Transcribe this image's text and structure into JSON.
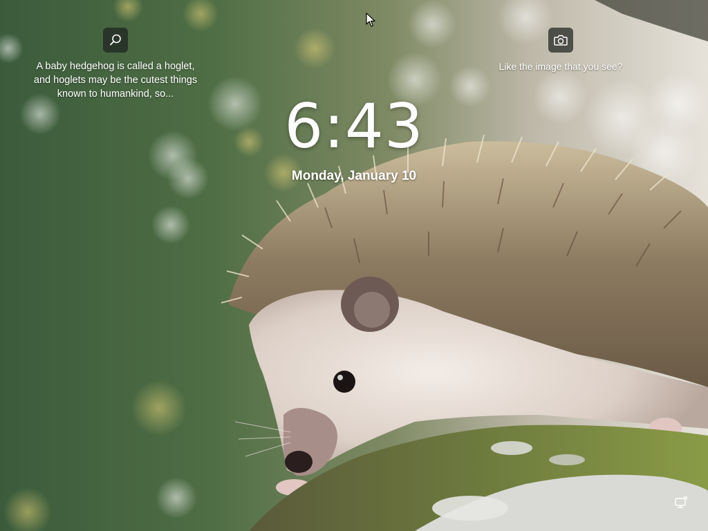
{
  "lockscreen": {
    "time": "6:43",
    "date": "Monday, January 10"
  },
  "spotlight": {
    "fact_icon": "search-icon",
    "fact_text_line1": "A baby hedgehog is called a hoglet,",
    "fact_text_line2": "and hoglets may be the cutest things",
    "fact_text_line3": "known to humankind, so...",
    "like_icon": "camera-icon",
    "like_text": "Like the image that you see?"
  },
  "system": {
    "network_icon": "network-icon"
  },
  "colors": {
    "text": "#ffffff",
    "icon_bg": "#1e231e"
  }
}
